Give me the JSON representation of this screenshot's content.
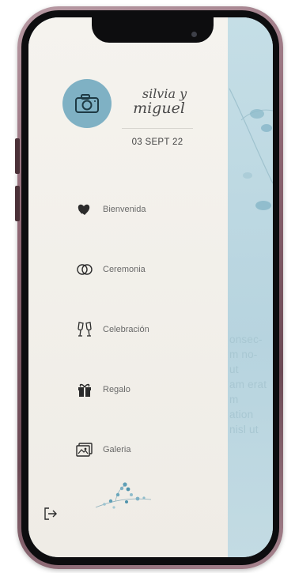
{
  "header": {
    "couple_names": "silvia y miguel",
    "name_line1": "silvia y",
    "name_line2": "miguel",
    "date": "03 SEPT 22"
  },
  "menu": [
    {
      "label": "Bienvenida",
      "icon": "heart-hands-icon"
    },
    {
      "label": "Ceremonia",
      "icon": "rings-icon"
    },
    {
      "label": "Celebración",
      "icon": "toast-glasses-icon"
    },
    {
      "label": "Regalo",
      "icon": "gift-icon"
    },
    {
      "label": "Galeria",
      "icon": "gallery-icon"
    }
  ],
  "background_text": [
    "onsec-",
    "m no-",
    "ut",
    "am erat",
    "m",
    "ation",
    "nisl ut"
  ],
  "colors": {
    "accent": "#7fb1c4",
    "drawer_bg": "#f3f1ec",
    "background_panel": "#b9d6e0",
    "phone_frame": "#8e6673"
  }
}
